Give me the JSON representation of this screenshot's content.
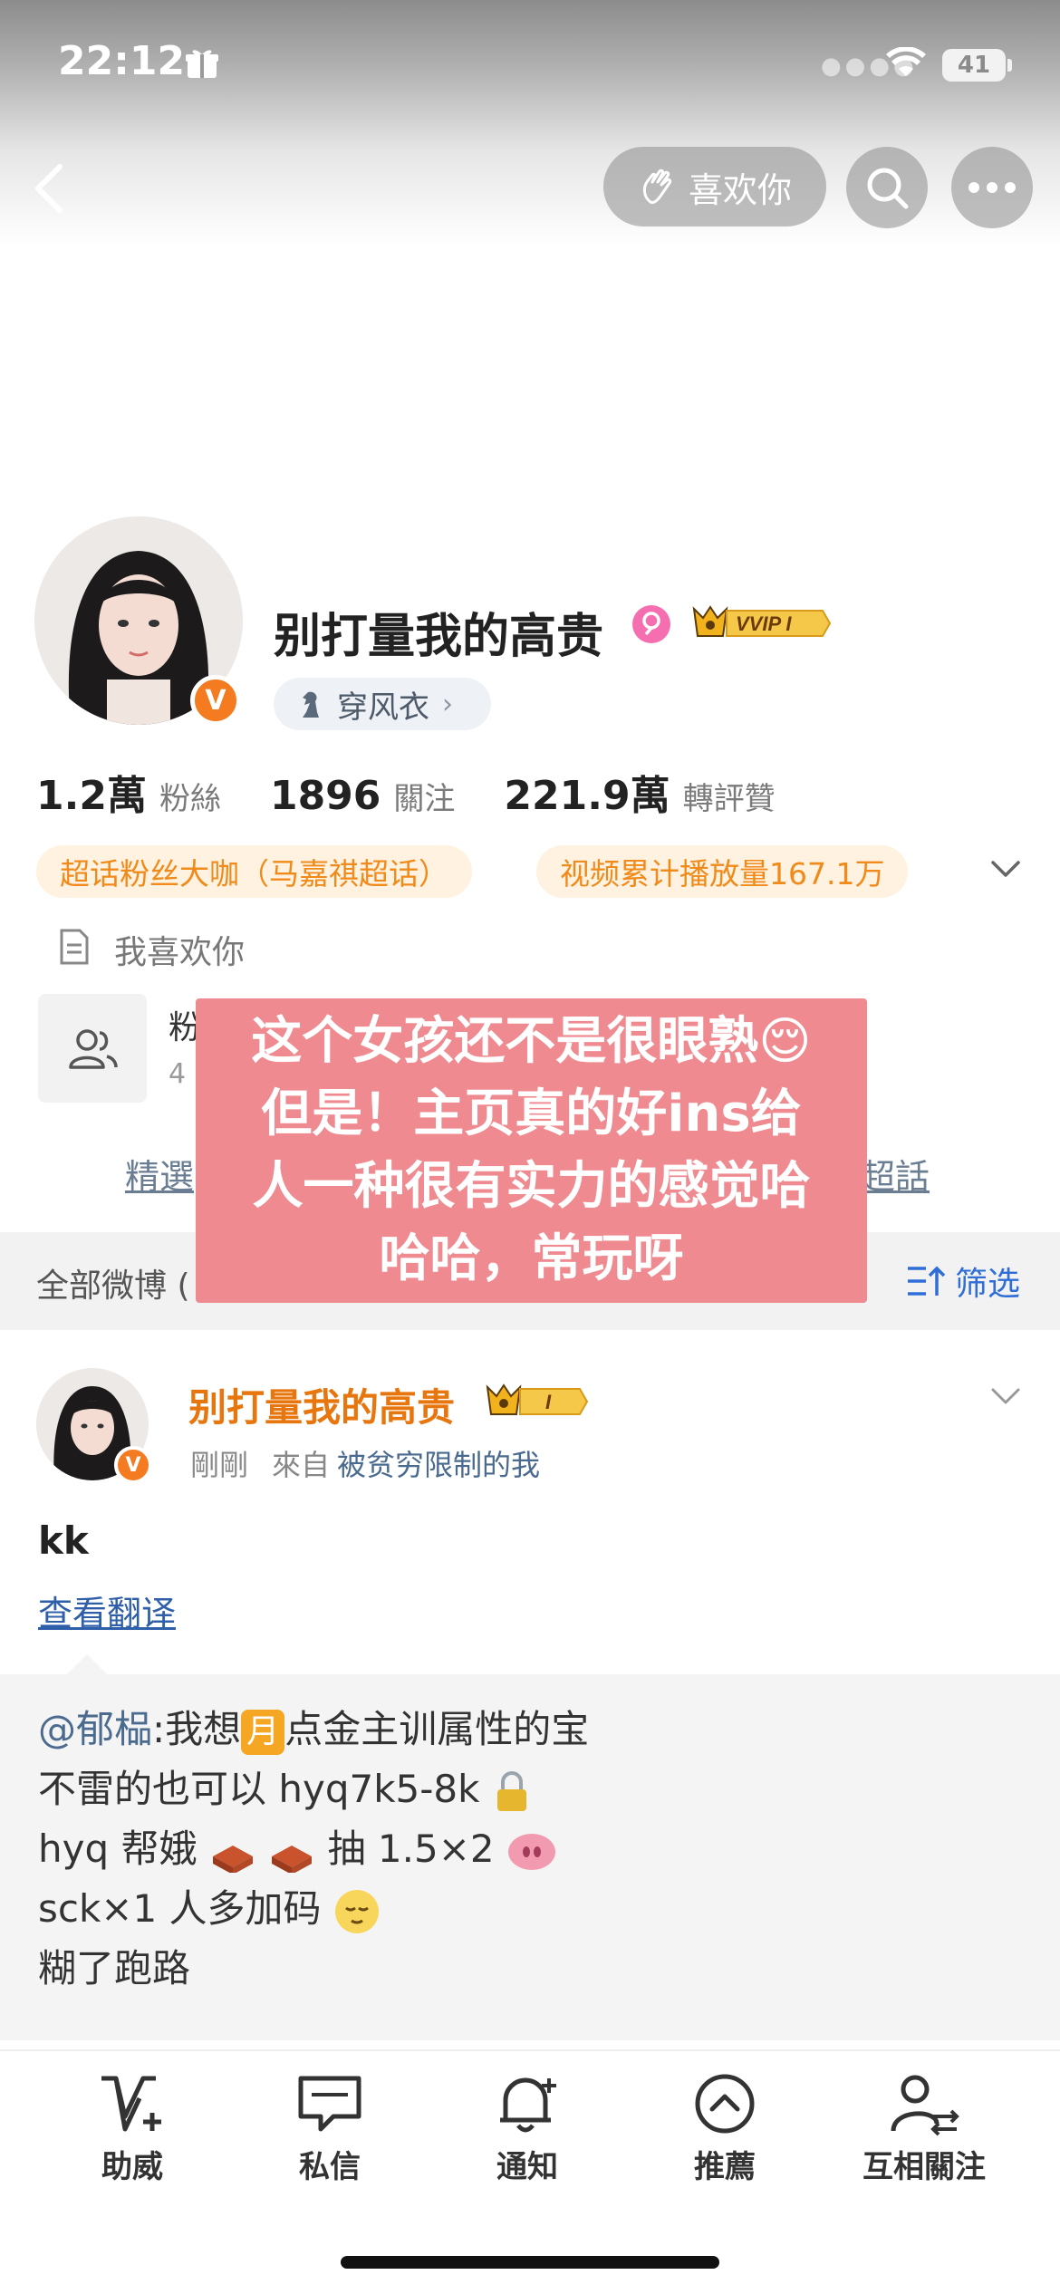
{
  "status_bar": {
    "time": "22:12",
    "battery": "41"
  },
  "header": {
    "like_label": "喜欢你"
  },
  "profile": {
    "name": "别打量我的高贵",
    "vip_badge": "VVIP I",
    "tag_label": "穿风衣",
    "stats": [
      {
        "value": "1.2萬",
        "label": "粉絲"
      },
      {
        "value": "1896",
        "label": "關注"
      },
      {
        "value": "221.9萬",
        "label": "轉評贊"
      }
    ],
    "badges": [
      "超话粉丝大咖（马嘉祺超话）",
      "视频累计播放量167.1万"
    ],
    "intro": "我喜欢你",
    "group_name": "粉",
    "group_sub": "4",
    "link_left": "精選",
    "link_right": "超話"
  },
  "overlay_text": {
    "line1": "这个女孩还不是很眼熟😌",
    "line2": "但是！主页真的好ins给",
    "line3": "人一种很有实力的感觉哈",
    "line4": "哈哈，常玩呀"
  },
  "tab_bar": {
    "all_label": "全部微博 (",
    "filter_label": "筛选"
  },
  "post": {
    "author": "别打量我的高贵",
    "vip_level": "I",
    "time": "剛剛",
    "source_prefix": "來自",
    "source": "被贫穷限制的我",
    "text": "kk",
    "translate_label": "查看翻译",
    "repost": {
      "mention": "@郁榀",
      "line1_a": ":我想",
      "line1_month": "月",
      "line1_b": "点金主训属性的宝",
      "line2": "不雷的也可以 hyq7k5-8k",
      "line3_a": "hyq 帮娥",
      "line3_b": "抽 1.5×2",
      "line4": "sck×1 人多加码",
      "line5": "糊了跑路"
    }
  },
  "bottom_nav": [
    {
      "label": "助威",
      "icon": "v-plus-icon"
    },
    {
      "label": "私信",
      "icon": "message-icon"
    },
    {
      "label": "通知",
      "icon": "bell-icon"
    },
    {
      "label": "推薦",
      "icon": "recommend-icon"
    },
    {
      "label": "互相關注",
      "icon": "mutual-follow-icon"
    }
  ],
  "colors": {
    "accent_orange": "#f08a1a",
    "link_blue": "#2f6ed6",
    "overlay_pink": "#ee8a90"
  }
}
